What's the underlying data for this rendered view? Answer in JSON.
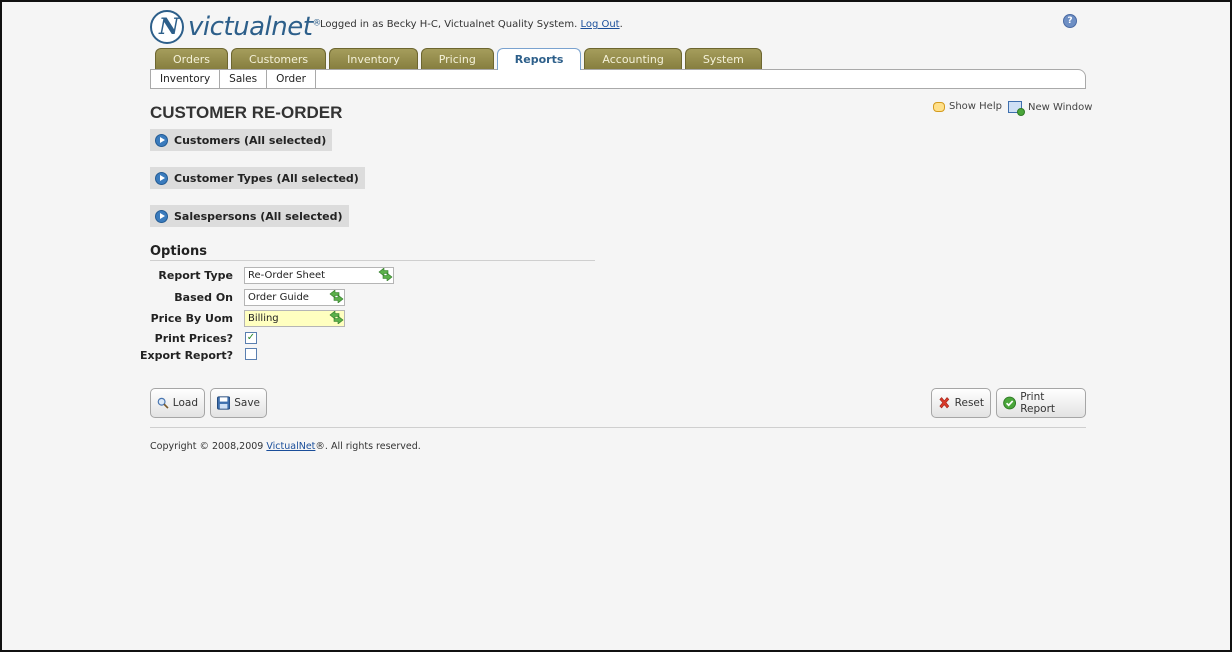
{
  "header": {
    "logo_text": "victualnet",
    "logo_mark": "N",
    "logo_reg": "®",
    "login_text": "Logged in as Becky H-C, Victualnet Quality System.",
    "logout_label": "Log Out",
    "login_suffix": ".",
    "help_label": "?"
  },
  "tabs": [
    "Orders",
    "Customers",
    "Inventory",
    "Pricing",
    "Reports",
    "Accounting",
    "System"
  ],
  "active_tab": "Reports",
  "subnav": [
    "Inventory",
    "Sales",
    "Order"
  ],
  "page": {
    "title": "CUSTOMER RE-ORDER",
    "show_help": "Show Help",
    "new_window": "New Window"
  },
  "filters": {
    "customers": "Customers (All selected)",
    "customer_types": "Customer Types (All selected)",
    "salespersons": "Salespersons (All selected)"
  },
  "options": {
    "title": "Options",
    "report_type_label": "Report Type",
    "report_type_value": "Re-Order Sheet",
    "based_on_label": "Based On",
    "based_on_value": "Order Guide",
    "price_by_uom_label": "Price By Uom",
    "price_by_uom_value": "Billing",
    "print_prices_label": "Print Prices?",
    "print_prices_checked": true,
    "print_prices_mark": "✓",
    "export_report_label": "Export Report?",
    "export_report_checked": false
  },
  "buttons": {
    "load": "Load",
    "save": "Save",
    "reset": "Reset",
    "print_report": "Print Report"
  },
  "footer": {
    "copyright_prefix": "Copyright © 2008,2009",
    "copyright_link": "VictualNet",
    "copyright_suffix": "®. All rights reserved."
  },
  "colors": {
    "tab_bg": "#857d3e",
    "active_tab_text": "#2d5f8a",
    "brand_blue": "#2d5f8a",
    "focus_field": "#ffffc0"
  }
}
